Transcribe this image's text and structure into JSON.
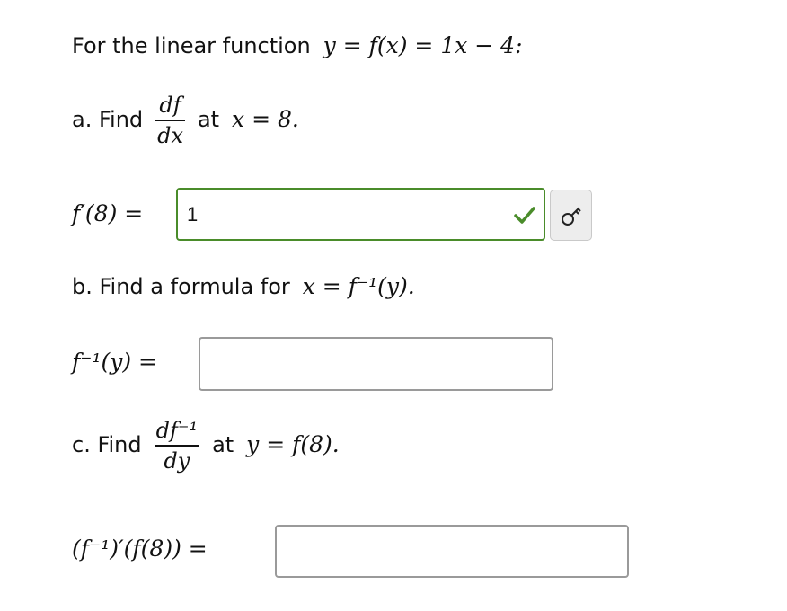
{
  "intro": {
    "text": "For the linear function",
    "formula": "y = f(x) = 1x − 4:"
  },
  "part_a": {
    "prefix": "a. Find",
    "frac_num": "df",
    "frac_den": "dx",
    "condition_text": "at",
    "condition": "x = 8.",
    "answer_label": "f′(8) =",
    "answer_value": "1",
    "status": "correct"
  },
  "part_b": {
    "prompt_text": "b. Find a formula for",
    "prompt_formula": "x = f⁻¹(y).",
    "answer_label": "f⁻¹(y) =",
    "answer_value": ""
  },
  "part_c": {
    "prefix": "c. Find",
    "frac_num": "df⁻¹",
    "frac_den": "dy",
    "condition_text": "at",
    "condition": "y = f(8).",
    "answer_label": "(f⁻¹)′(f(8)) =",
    "answer_value": ""
  },
  "colors": {
    "correct_border": "#4a8c2a",
    "check": "#4a8c2a",
    "empty_border": "#9a9a9a"
  },
  "icons": {
    "check": "check-icon",
    "key": "key-icon"
  }
}
